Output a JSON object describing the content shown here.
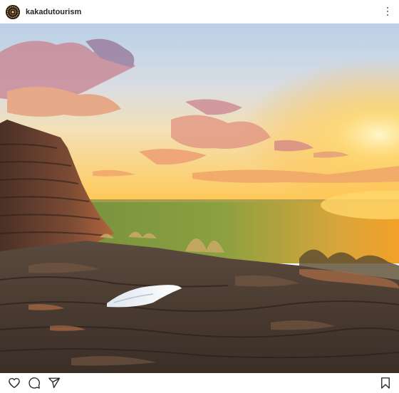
{
  "post": {
    "username": "kakadutourism",
    "avatar_icon": "kakadu-logo-avatar",
    "photo_alt": ""
  },
  "actions": {
    "like_icon": "heart-icon",
    "comment_icon": "comment-icon",
    "share_icon": "paper-plane-icon",
    "save_icon": "bookmark-icon",
    "more_icon": "more-vertical-icon"
  },
  "colors": {
    "text": "#262626",
    "background": "#ffffff"
  }
}
